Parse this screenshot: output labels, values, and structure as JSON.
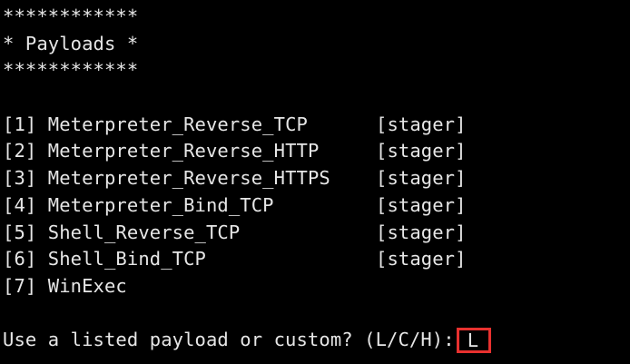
{
  "banner": {
    "top": "************",
    "title": "* Payloads *",
    "bottom": "************"
  },
  "payloads": [
    {
      "index": "[1]",
      "name": "Meterpreter_Reverse_TCP",
      "type": "[stager]"
    },
    {
      "index": "[2]",
      "name": "Meterpreter_Reverse_HTTP",
      "type": "[stager]"
    },
    {
      "index": "[3]",
      "name": "Meterpreter_Reverse_HTTPS",
      "type": "[stager]"
    },
    {
      "index": "[4]",
      "name": "Meterpreter_Bind_TCP",
      "type": "[stager]"
    },
    {
      "index": "[5]",
      "name": "Shell_Reverse_TCP",
      "type": "[stager]"
    },
    {
      "index": "[6]",
      "name": "Shell_Bind_TCP",
      "type": "[stager]"
    },
    {
      "index": "[7]",
      "name": "WinExec",
      "type": ""
    }
  ],
  "prompt": {
    "text": "Use a listed payload or custom? (L/C/H):",
    "input_value": "L"
  },
  "colors": {
    "background": "#000000",
    "text": "#e6e6e6",
    "highlight_box": "#e8312f"
  }
}
